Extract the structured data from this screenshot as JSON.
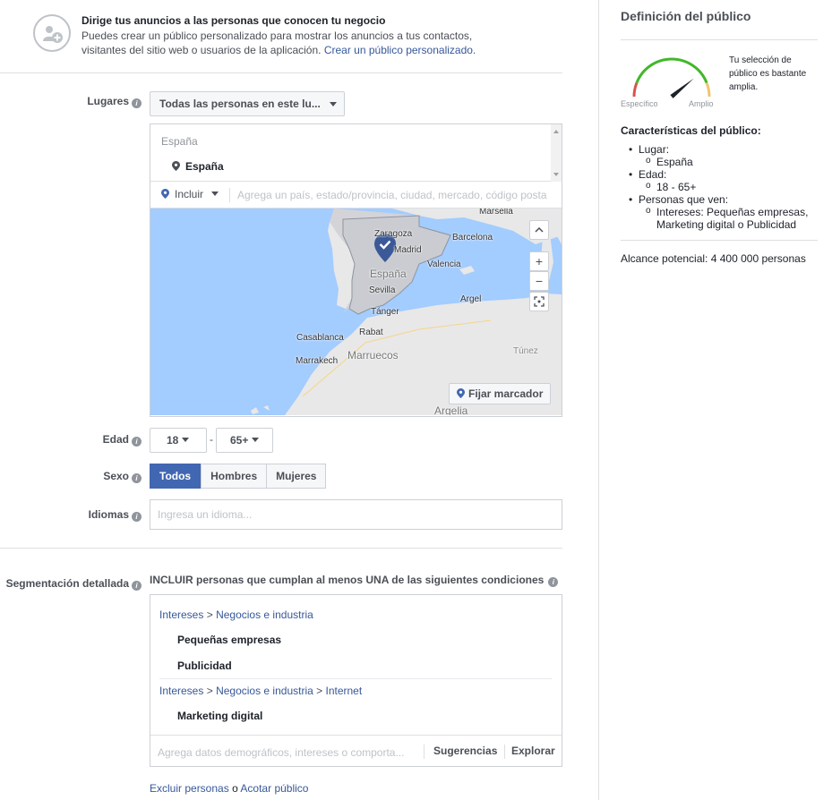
{
  "banner": {
    "title": "Dirige tus anuncios a las personas que conocen tu negocio",
    "text_line1": "Puedes crear un público personalizado para mostrar los anuncios a tus contactos,",
    "text_line2": "visitantes del sitio web o usuarios de la aplicación.",
    "link": "Crear un público personalizado."
  },
  "locations": {
    "label": "Lugares",
    "dropdown_value": "Todas las personas en este lu...",
    "list_header": "España",
    "items": [
      "España"
    ],
    "include_label": "Incluir",
    "input_placeholder": "Agrega un país, estado/provincia, ciudad, mercado, código posta"
  },
  "map": {
    "labels": {
      "marsella": "Marsella",
      "zaragoza": "Zaragoza",
      "barcelona": "Barcelona",
      "madrid": "Madrid",
      "espana": "España",
      "valencia": "Valencia",
      "sevilla": "Sevilla",
      "argel": "Argel",
      "tanger": "Tánger",
      "rabat": "Rabat",
      "casablanca": "Casablanca",
      "marruecos": "Marruecos",
      "marrakech": "Marrakech",
      "tunez": "Túnez",
      "argelia": "Argelia"
    },
    "zoom_in": "+",
    "zoom_out": "−",
    "pin_button": "Fijar marcador"
  },
  "age": {
    "label": "Edad",
    "min": "18",
    "separator": "-",
    "max": "65+"
  },
  "gender": {
    "label": "Sexo",
    "options": [
      "Todos",
      "Hombres",
      "Mujeres"
    ],
    "selected": "Todos"
  },
  "languages": {
    "label": "Idiomas",
    "placeholder": "Ingresa un idioma..."
  },
  "detailed": {
    "label": "Segmentación detallada",
    "header": "INCLUIR personas que cumplan al menos UNA de las siguientes condiciones",
    "groups": [
      {
        "path": [
          "Intereses",
          "Negocios e industria"
        ],
        "items": [
          "Pequeñas empresas",
          "Publicidad"
        ]
      },
      {
        "path": [
          "Intereses",
          "Negocios e industria",
          "Internet"
        ],
        "items": [
          "Marketing digital"
        ]
      }
    ],
    "sep": ">",
    "input_placeholder": "Agrega datos demográficos, intereses o comporta...",
    "suggestions": "Sugerencias",
    "explore": "Explorar"
  },
  "footer_links": {
    "exclude": "Excluir personas",
    "or": "o",
    "narrow": "Acotar público"
  },
  "sidebar": {
    "title": "Definición del público",
    "gauge_note": "Tu selección de público es bastante amplia.",
    "gauge_left": "Específico",
    "gauge_right": "Amplio",
    "gauge_fraction": 0.78,
    "chars_title": "Características del público:",
    "place_label": "Lugar:",
    "place_value": "España",
    "age_label": "Edad:",
    "age_value": "18 - 65+",
    "people_label": "Personas que ven:",
    "people_value_1": "Intereses: Pequeñas empresas,",
    "people_value_2": "Marketing digital o Publicidad",
    "reach": "Alcance potencial: 4 400 000 personas"
  },
  "colors": {
    "accent": "#4267b2",
    "link": "#365899",
    "map_water": "#a3ccff",
    "map_land": "#e8e8e8",
    "gauge_red": "#d9534f",
    "gauge_green": "#42b72a",
    "gauge_yellow": "#f2c46f"
  }
}
